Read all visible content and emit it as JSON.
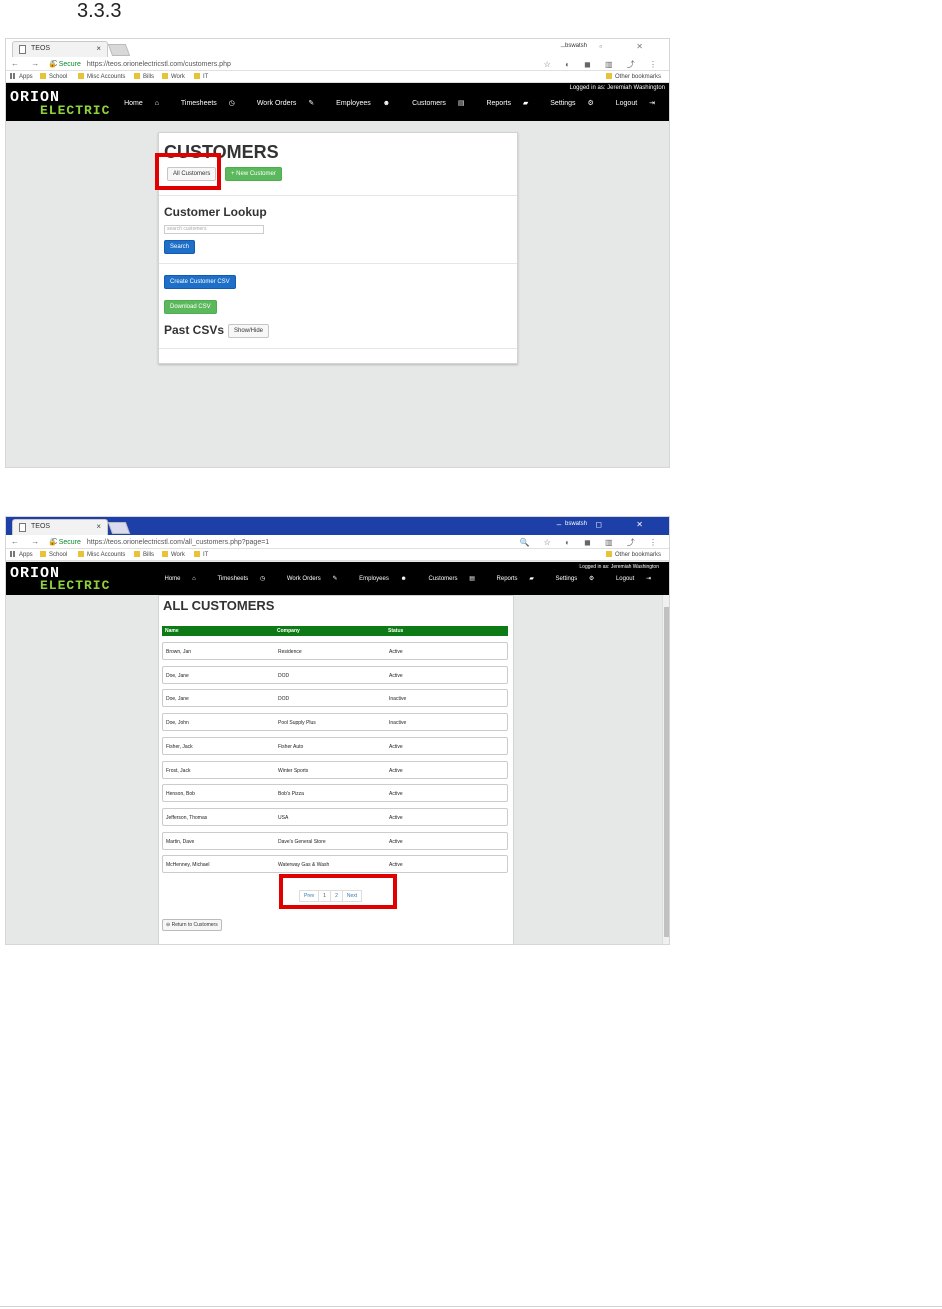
{
  "section_number": "3.3.3",
  "colors": {
    "nav_black": "#000000",
    "logo_green": "#8fd13c",
    "table_header_green": "#0d7a16",
    "primary_blue": "#1d6fc7",
    "success_green": "#5cb85c",
    "highlight_red": "#e00000",
    "active_tabbar_blue": "#1c3fa8"
  },
  "screenshot1": {
    "browser": {
      "tab_title": "TEOS",
      "tab_close": "×",
      "profile": "bswatsh",
      "window_controls": "–  ▫  ✕",
      "nav_buttons": "← → C",
      "secure_label": "Secure",
      "url": "https://teos.orionelectricstl.com/customers.php",
      "addr_icons": "☆ ◐ ◼ ▥ ⤴ ⋮",
      "bookmarks": [
        "Apps",
        "School",
        "Misc Accounts",
        "Bills",
        "Work",
        "IT"
      ],
      "other_bookmarks": "Other bookmarks"
    },
    "site": {
      "logo_top": "ORION",
      "logo_bottom": "ELECTRIC",
      "logged_in": "Logged in as: Jeremiah Washington",
      "nav": [
        "Home",
        "Timesheets",
        "Work Orders",
        "Employees",
        "Customers",
        "Reports",
        "Settings",
        "Logout"
      ],
      "nav_icons": [
        "home-icon",
        "clock-icon",
        "edit-icon",
        "group-icon",
        "list-icon",
        "book-icon",
        "gears-icon",
        "logout-icon"
      ]
    },
    "page": {
      "title": "CUSTOMERS",
      "all_customers_button": "All Customers",
      "new_customer_button": "+ New Customer",
      "lookup_heading": "Customer Lookup",
      "search_placeholder": "search customers",
      "search_button": "Search",
      "create_csv_button": "Create Customer CSV",
      "download_csv_button": "Download CSV",
      "past_csvs_heading": "Past CSVs",
      "show_hide_button": "Show/Hide"
    }
  },
  "screenshot2": {
    "browser": {
      "tab_title": "TEOS",
      "tab_close": "×",
      "profile": "bswatsh",
      "window_controls": "–  ◻  ✕",
      "nav_buttons": "← → C",
      "secure_label": "Secure",
      "url": "https://teos.orionelectricstl.com/all_customers.php?page=1",
      "addr_icons": "🔍 ☆ ◐ ◼ ▥ ⤴ ⋮",
      "bookmarks": [
        "Apps",
        "School",
        "Misc Accounts",
        "Bills",
        "Work",
        "IT"
      ],
      "other_bookmarks": "Other bookmarks"
    },
    "site": {
      "logo_top": "ORION",
      "logo_bottom": "ELECTRIC",
      "logged_in": "Logged in as: Jeremiah Washington",
      "nav": [
        "Home",
        "Timesheets",
        "Work Orders",
        "Employees",
        "Customers",
        "Reports",
        "Settings",
        "Logout"
      ]
    },
    "page": {
      "title": "ALL CUSTOMERS",
      "columns": [
        "Name",
        "Company",
        "Status"
      ],
      "rows": [
        [
          "Brown, Jan",
          "Residence",
          "Active"
        ],
        [
          "Doe, Jane",
          "DOD",
          "Active"
        ],
        [
          "Doe, Jane",
          "DOD",
          "Inactive"
        ],
        [
          "Doe, John",
          "Pool Supply Plus",
          "Inactive"
        ],
        [
          "Fisher, Jack",
          "Fisher Auto",
          "Active"
        ],
        [
          "Frost, Jack",
          "Winter Sports",
          "Active"
        ],
        [
          "Henson, Bob",
          "Bob's Pizza",
          "Active"
        ],
        [
          "Jefferson, Thomas",
          "USA",
          "Active"
        ],
        [
          "Martin, Dave",
          "Dave's General Store",
          "Active"
        ],
        [
          "McHenney, Michael",
          "Waterway Gas & Wash",
          "Active"
        ]
      ],
      "pagination": {
        "prev": "Prev",
        "pages": [
          "1",
          "2"
        ],
        "next": "Next",
        "current_page": "1"
      },
      "return_button": "⊖ Return to Customers"
    }
  }
}
